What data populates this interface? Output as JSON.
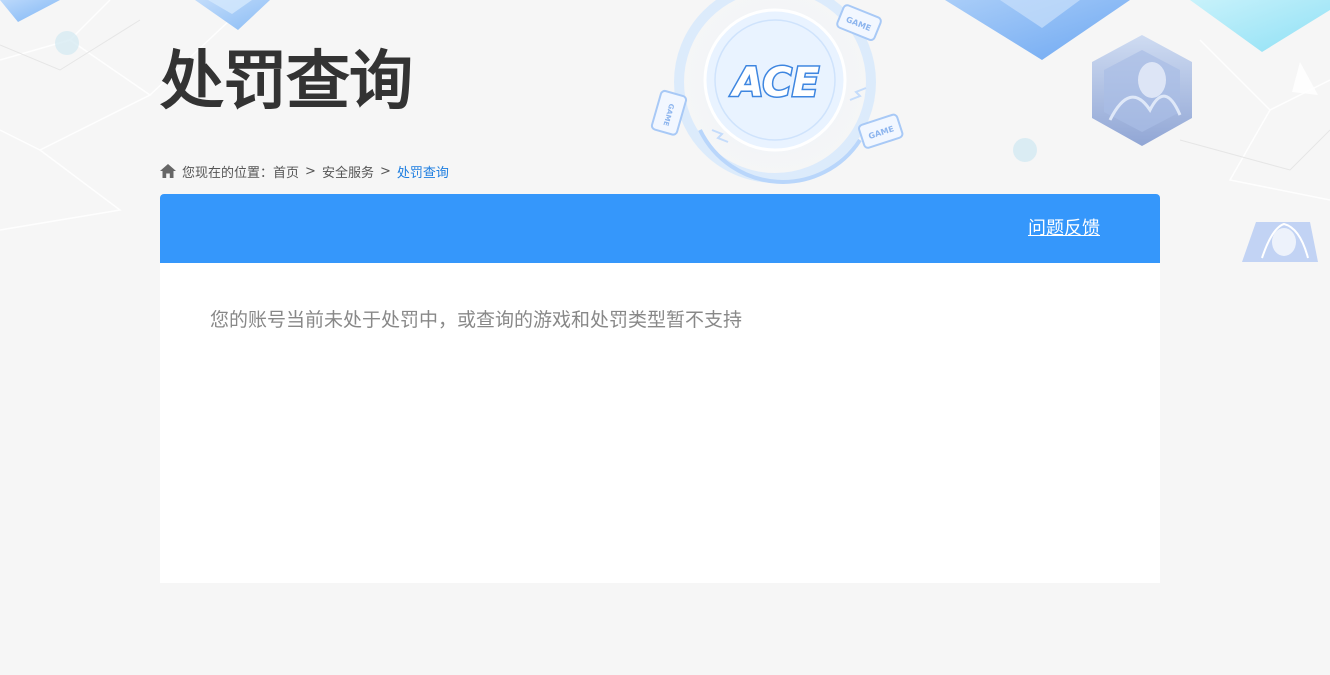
{
  "page": {
    "title": "处罚查询"
  },
  "breadcrumb": {
    "icon": "home-icon",
    "prefix": "您现在的位置：",
    "items": [
      "首页",
      "安全服务"
    ],
    "current": "处罚查询",
    "separator": ">"
  },
  "panel": {
    "feedback_label": "问题反馈",
    "message": "您的账号当前未处于处罚中，或查询的游戏和处罚类型暂不支持"
  },
  "decor": {
    "logo_text": "ACE",
    "badge_text": "GAME"
  },
  "colors": {
    "header_blue": "#3597fb",
    "link_blue": "#1e7ee0",
    "title": "#333333",
    "message": "#888888",
    "background": "#f6f6f6"
  }
}
